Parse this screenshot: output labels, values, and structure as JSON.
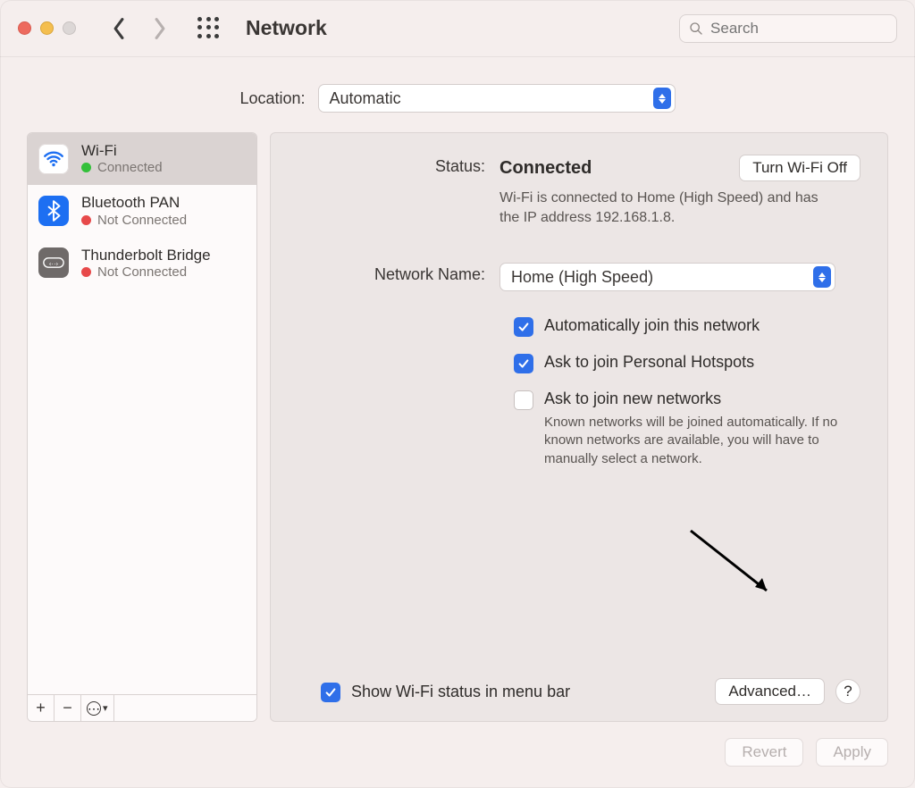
{
  "titlebar": {
    "title": "Network",
    "search_placeholder": "Search"
  },
  "location": {
    "label": "Location:",
    "selected": "Automatic"
  },
  "sidebar": {
    "items": [
      {
        "name": "Wi-Fi",
        "status": "Connected",
        "dot": "green",
        "icon": "wifi",
        "selected": true
      },
      {
        "name": "Bluetooth PAN",
        "status": "Not Connected",
        "dot": "red",
        "icon": "bt",
        "selected": false
      },
      {
        "name": "Thunderbolt Bridge",
        "status": "Not Connected",
        "dot": "red",
        "icon": "tb",
        "selected": false
      }
    ],
    "toolbar": {
      "add": "+",
      "remove": "−",
      "more": "⋯"
    }
  },
  "detail": {
    "status_label": "Status:",
    "status_value": "Connected",
    "wifi_off_btn": "Turn Wi-Fi Off",
    "status_desc": "Wi-Fi is connected to Home (High Speed) and has the IP address 192.168.1.8.",
    "network_label": "Network Name:",
    "network_selected": "Home (High Speed)",
    "checks": {
      "auto_join": {
        "label": "Automatically join this network",
        "checked": true
      },
      "ask_hotspots": {
        "label": "Ask to join Personal Hotspots",
        "checked": true
      },
      "ask_new": {
        "label": "Ask to join new networks",
        "checked": false,
        "desc": "Known networks will be joined automatically. If no known networks are available, you will have to manually select a network."
      }
    },
    "show_status_label": "Show Wi-Fi status in menu bar",
    "advanced_btn": "Advanced…",
    "help_btn": "?"
  },
  "footer": {
    "revert": "Revert",
    "apply": "Apply"
  }
}
